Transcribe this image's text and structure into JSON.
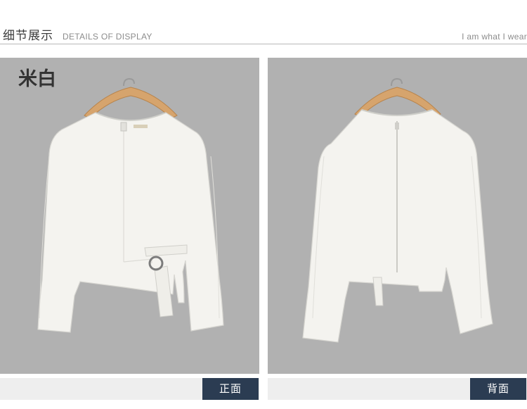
{
  "header": {
    "title_cn": "细节展示",
    "title_en": "DETAILS OF DISPLAY",
    "slogan": "I am what I wear"
  },
  "panels": {
    "left": {
      "color_label": "米白",
      "view_label": "正面"
    },
    "right": {
      "view_label": "背面"
    }
  },
  "colors": {
    "background": "#b1b1b1",
    "garment": "#f4f3ef",
    "tag_bg": "#2b3c52",
    "hanger": "#d6a46d"
  }
}
